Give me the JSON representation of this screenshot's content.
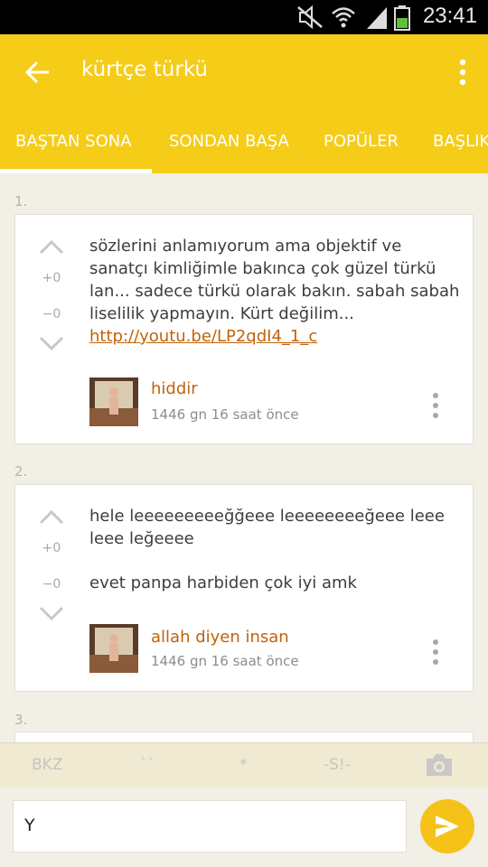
{
  "status": {
    "time": "23:41"
  },
  "appbar": {
    "title": "kürtçe türkü"
  },
  "tabs": [
    "BAŞTAN SONA",
    "SONDAN BAŞA",
    "POPÜLER",
    "BAŞLIK"
  ],
  "entries": [
    {
      "number": "1.",
      "up_score": "+0",
      "down_score": "−0",
      "text": "sözlerini anlamıyorum ama objektif ve sanatçı kimliğimle bakınca çok güzel türkü lan... sadece türkü olarak bakın. sabah sabah liselilik yapmayın. Kürt değilim... ",
      "link": "http://youtu.be/LP2qdI4_1_c",
      "author": "hiddir",
      "time": "1446 gn 16 saat  önce"
    },
    {
      "number": "2.",
      "up_score": "+0",
      "down_score": "−0",
      "text_line1": "hele leeeeeeeeeğğeee leeeeeeeeğeee leee leee leğeeee",
      "text_line2": "evet panpa harbiden çok iyi amk",
      "author": "allah diyen insan",
      "time": "1446 gn 16 saat  önce"
    },
    {
      "number": "3."
    }
  ],
  "format_bar": {
    "bkz": "BKZ",
    "backtick": "``",
    "star": "*",
    "spoiler": "-S!-"
  },
  "input": {
    "value": "Y"
  },
  "colors": {
    "accent": "#f5cc18",
    "link": "#c2620a",
    "send": "#f5c21a"
  }
}
